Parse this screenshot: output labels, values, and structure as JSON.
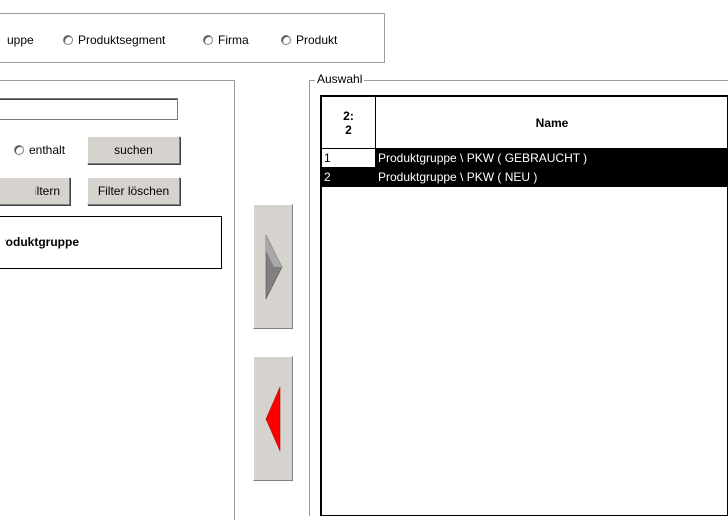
{
  "radio_group": {
    "options": [
      {
        "label": "uppe"
      },
      {
        "label": "Produktsegment"
      },
      {
        "label": "Firma"
      },
      {
        "label": "Produkt"
      }
    ]
  },
  "search": {
    "value": "",
    "contains_label": "enthalt",
    "search_button": "suchen",
    "filter_button": "Filtern",
    "clear_filter_button": "Filter löschen"
  },
  "left_list": {
    "header": "Produktgruppe"
  },
  "selection": {
    "group_label": "Auswahl",
    "columns": {
      "count_line1": "2:",
      "count_line2": "2",
      "name": "Name"
    },
    "rows": [
      {
        "num": "1",
        "name": "Produktgruppe \\ PKW ( GEBRAUCHT )",
        "num_selected": false
      },
      {
        "num": "2",
        "name": "Produktgruppe \\ PKW ( NEU )",
        "num_selected": true
      }
    ]
  },
  "arrows": {
    "add_color": "#808080",
    "remove_color": "#ff0000"
  }
}
